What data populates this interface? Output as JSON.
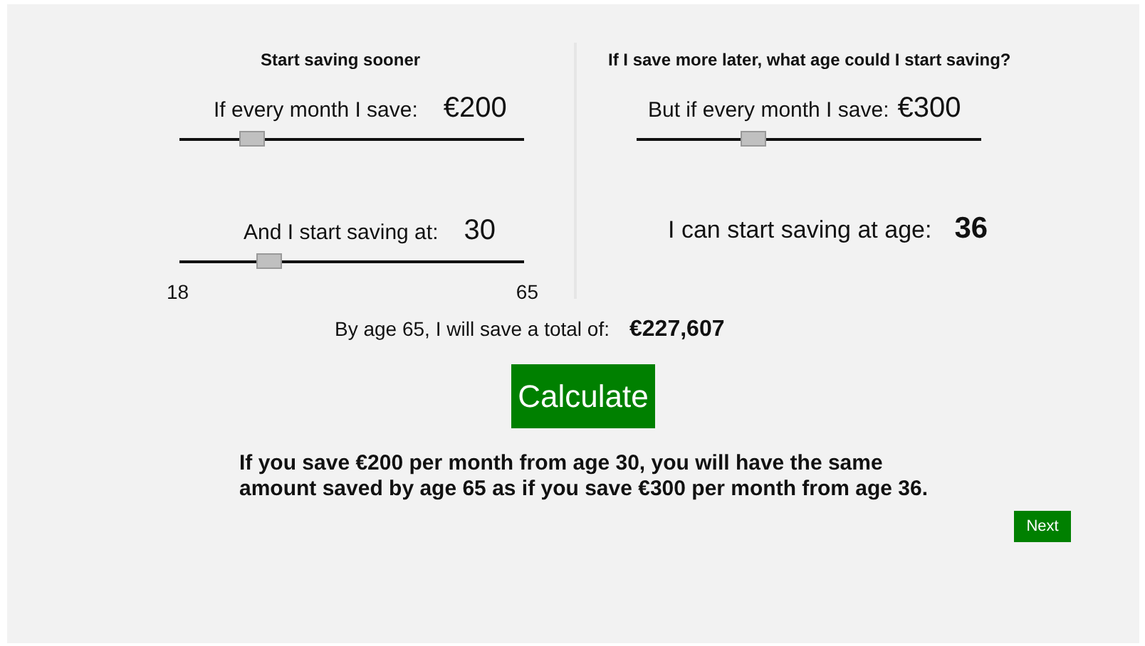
{
  "left": {
    "title": "Start saving sooner",
    "monthly": {
      "label": "If every month I save:",
      "value": "€200",
      "level": 0.21
    },
    "age": {
      "label": "And I start saving at:",
      "value": "30",
      "level": 0.26,
      "min": "18",
      "max": "65"
    }
  },
  "right": {
    "title": "If I save more later, what age could I start saving?",
    "monthly": {
      "label": "But if every month I save:",
      "value": "€300",
      "level": 0.34
    },
    "result": {
      "label": "I can start saving at age:",
      "value": "36"
    }
  },
  "total": {
    "label": "By age 65, I will save a total of:",
    "value": "€227,607"
  },
  "calculate_button": "Calculate",
  "summary": "If you save €200 per month from age 30, you will have the same amount saved by age 65 as if you save €300 per month from age 36.",
  "next_button": "Next"
}
